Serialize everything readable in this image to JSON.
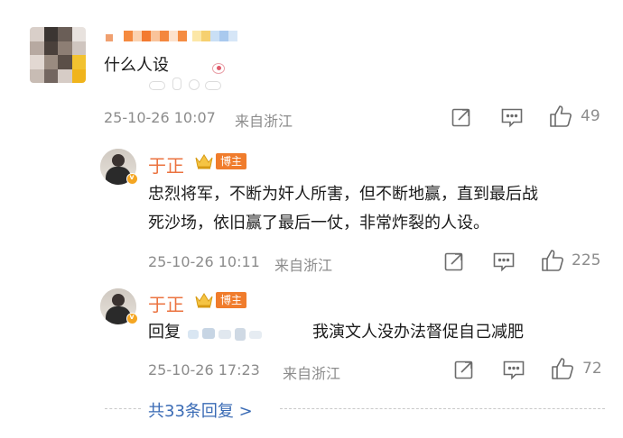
{
  "top_comment": {
    "text": "什么人设",
    "timestamp": "25-10-26 10:07",
    "location": "来自浙江",
    "likes": "49"
  },
  "replies": [
    {
      "author": "于正",
      "badge": "博主",
      "text_line1": "忠烈将军，不断为奸人所害，但不断地赢，直到最后战",
      "text_line2": "死沙场，依旧赢了最后一仗，非常炸裂的人设。",
      "timestamp": "25-10-26 10:11",
      "location": "来自浙江",
      "likes": "225"
    },
    {
      "author": "于正",
      "badge": "博主",
      "reply_prefix": "回复",
      "text": "我演文人没办法督促自己减肥",
      "timestamp": "25-10-26 17:23",
      "location": "来自浙江",
      "likes": "72"
    }
  ],
  "more_replies_label": "共33条回复 >",
  "colors": {
    "author": "#eb7340",
    "badge": "#f07c2c",
    "link": "#3a6bb5",
    "meta": "#8c8c8c"
  },
  "icons": {
    "share": "share-icon",
    "comment": "comment-icon",
    "like": "thumbs-up-icon",
    "crown": "crown-icon"
  }
}
